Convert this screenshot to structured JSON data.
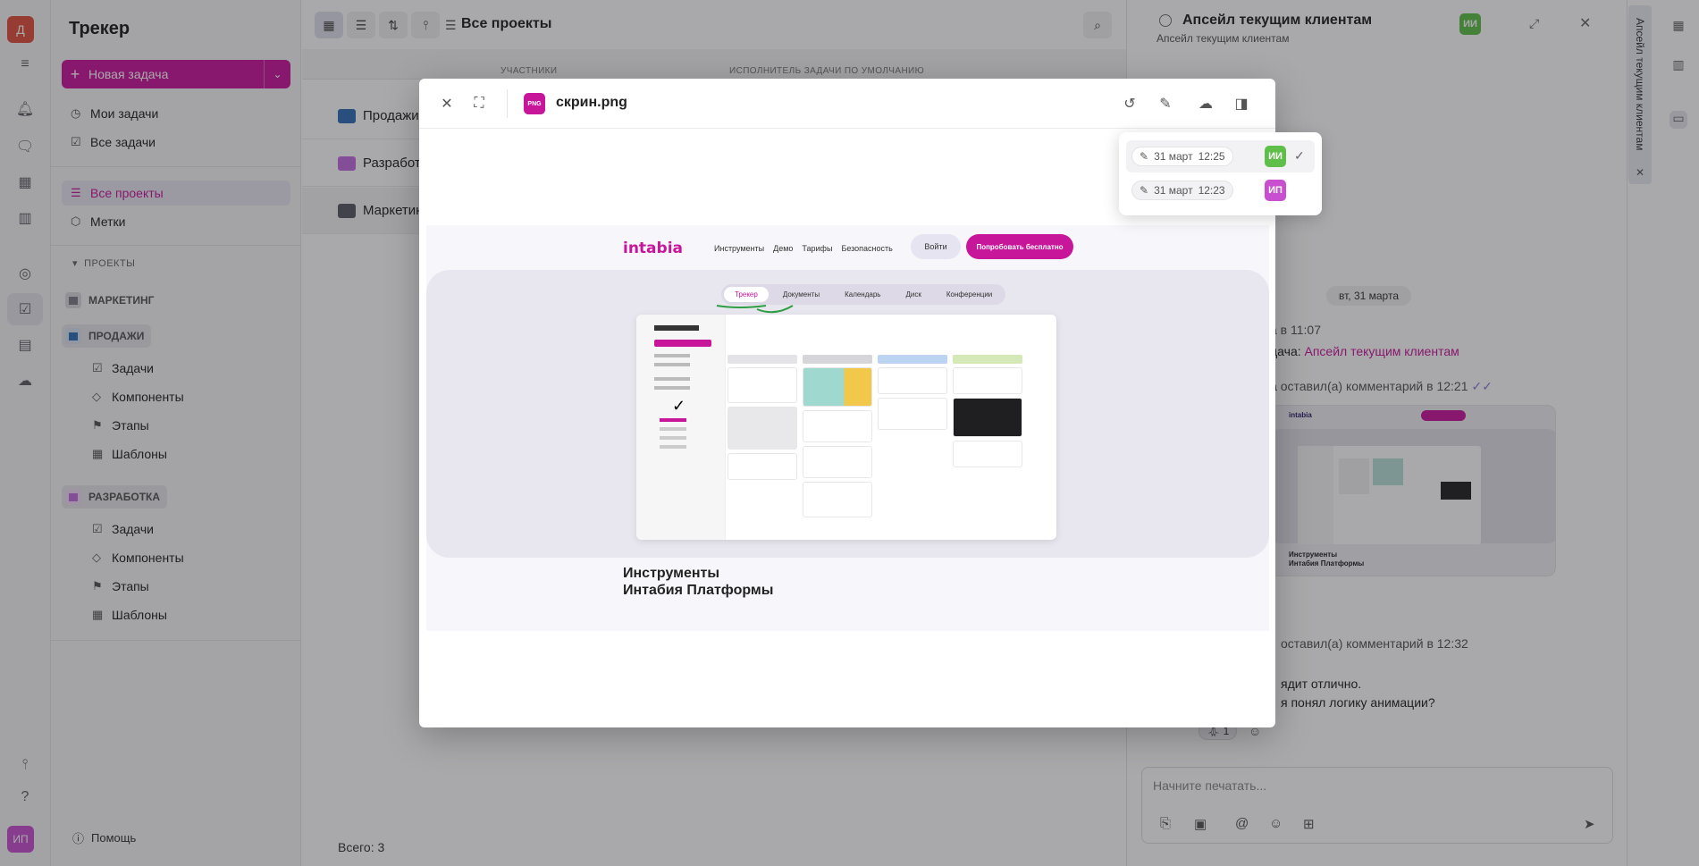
{
  "rail": {
    "user_initial": "Д",
    "user_initials_bottom": "ИП"
  },
  "sidebar": {
    "app_title": "Трекер",
    "new_task_label": "Новая задача",
    "my_tasks": "Мои задачи",
    "all_tasks": "Все задачи",
    "all_projects": "Все проекты",
    "tags": "Метки",
    "projects_heading": "ПРОЕКТЫ",
    "projects": [
      {
        "name": "МАРКЕТИНГ",
        "color": "#7c7c86"
      },
      {
        "name": "ПРОДАЖИ",
        "color": "#2f6fb7"
      },
      {
        "name": "РАЗРАБОТКА",
        "color": "#c46be0"
      }
    ],
    "sales_items": [
      "Задачи",
      "Компоненты",
      "Этапы",
      "Шаблоны"
    ],
    "dev_items": [
      "Задачи",
      "Компоненты",
      "Этапы",
      "Шаблоны"
    ],
    "help": "Помощь"
  },
  "main": {
    "title": "Все проекты",
    "col_members": "УЧАСТНИКИ",
    "col_assignee": "ИСПОЛНИТЕЛЬ ЗАДАЧИ ПО УМОЛЧАНИЮ",
    "rows": [
      {
        "name": "Продажи",
        "color": "#2f6fb7"
      },
      {
        "name": "Разработка",
        "color": "#c46be0"
      },
      {
        "name": "Маркетинг",
        "color": "#5a5a63"
      }
    ],
    "total": "Всего: 3"
  },
  "right_panel": {
    "title": "Апсейл текущим клиентам",
    "subtitle": "Апсейл текущим клиентам",
    "badge": "ИИ",
    "date_divider": "вт, 31 марта",
    "msg1_suffix": "а в 11:07",
    "msg2_prefix": "дача: ",
    "msg2_link": "Апсейл текущим клиентам",
    "msg3": "а",
    "msg3_action": "оставил(а) комментарий в 12:21",
    "preview_caption_1": "Инструменты",
    "preview_caption_2": "Интабия Платформы",
    "msg4_action": "оставил(а) комментарий в 12:32",
    "msg5": "ядит отлично.",
    "msg6": "я понял логику анимации?",
    "reaction_count": "1",
    "composer_placeholder": "Начните печатать..."
  },
  "strip": {
    "vertical_tab": "Апсейл текущим клиентам"
  },
  "modal": {
    "file_badge": "PNG",
    "file_name": "скрин.png",
    "site": {
      "logo": "intabia",
      "nav": [
        "Инструменты",
        "Демо",
        "Тарифы",
        "Безопасность"
      ],
      "login": "Войти",
      "try": "Попробовать бесплатно",
      "tabs": [
        "Трекер",
        "Документы",
        "Календарь",
        "Диск",
        "Конференции"
      ],
      "caption_1": "Инструменты",
      "caption_2": "Интабия Платформы"
    }
  },
  "versions": [
    {
      "date": "31 март",
      "time": "12:25",
      "initials": "ИИ",
      "color": "#5fbf4a",
      "current": true
    },
    {
      "date": "31 март",
      "time": "12:23",
      "initials": "ИП",
      "color": "#c84fcf",
      "current": false
    }
  ],
  "colors": {
    "accent": "#c8169b",
    "avatar_red": "#e0503c",
    "avatar_green": "#5fbf4a",
    "avatar_purple": "#c84fcf"
  }
}
